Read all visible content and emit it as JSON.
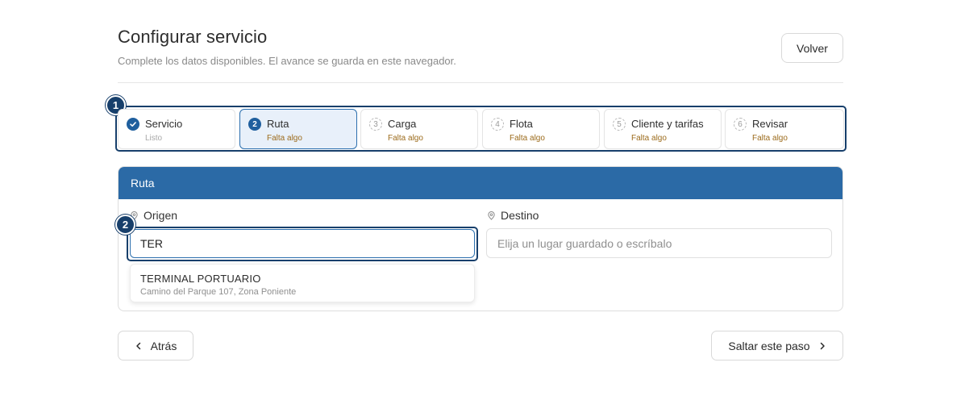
{
  "header": {
    "title": "Configurar servicio",
    "subtitle": "Complete los datos disponibles. El avance se guarda en este navegador.",
    "back_label": "Volver"
  },
  "markers": [
    "1",
    "2"
  ],
  "steps": [
    {
      "number": "1",
      "title": "Servicio",
      "status": "Listo",
      "state": "done"
    },
    {
      "number": "2",
      "title": "Ruta",
      "status": "Falta algo",
      "state": "current"
    },
    {
      "number": "3",
      "title": "Carga",
      "status": "Falta algo",
      "state": "pending"
    },
    {
      "number": "4",
      "title": "Flota",
      "status": "Falta algo",
      "state": "pending"
    },
    {
      "number": "5",
      "title": "Cliente y tarifas",
      "status": "Falta algo",
      "state": "pending"
    },
    {
      "number": "6",
      "title": "Revisar",
      "status": "Falta algo",
      "state": "pending"
    }
  ],
  "route_card": {
    "title": "Ruta",
    "origin": {
      "label": "Origen",
      "value": "TER",
      "icon": "map-pin-icon"
    },
    "destination": {
      "label": "Destino",
      "value": "",
      "placeholder": "Elija un lugar guardado o escríbalo",
      "icon": "map-pin-icon"
    },
    "suggestions": [
      {
        "name": "TERMINAL PORTUARIO",
        "address": "Camino del Parque 107, Zona Poniente"
      }
    ]
  },
  "footer": {
    "back_label": "Atrás",
    "skip_label": "Saltar este paso"
  },
  "colors": {
    "accent": "#2b6aa6",
    "highlight": "#173f6b",
    "warning_text": "#9c6b1c"
  }
}
